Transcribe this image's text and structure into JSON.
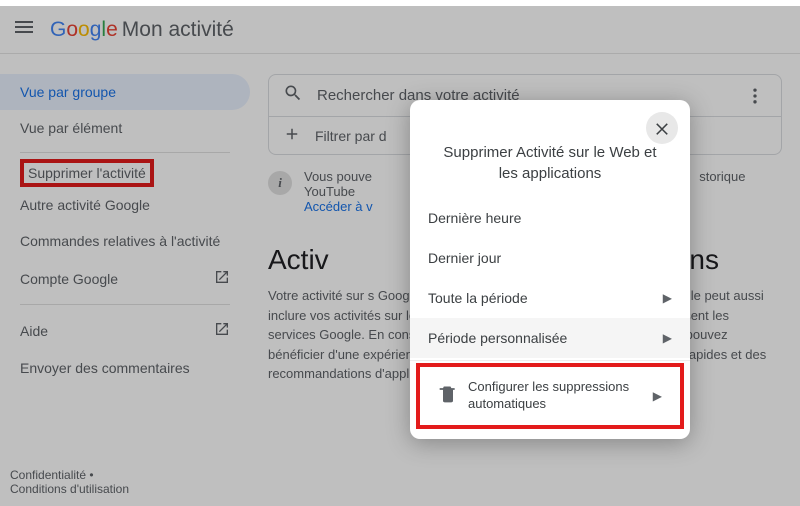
{
  "appbar": {
    "logo_word": "Google",
    "app_name": "Mon activité"
  },
  "sidebar": {
    "items": [
      {
        "label": "Vue par groupe"
      },
      {
        "label": "Vue par élément"
      },
      {
        "label": "Supprimer l'activité"
      },
      {
        "label": "Autre activité Google"
      },
      {
        "label": "Commandes relatives à l'activité"
      },
      {
        "label": "Compte Google"
      },
      {
        "label": "Aide"
      },
      {
        "label": "Envoyer des commentaires"
      }
    ]
  },
  "footer": {
    "privacy": "Confidentialité",
    "sep": " • ",
    "terms": "Conditions d'utilisation"
  },
  "search": {
    "placeholder": "Rechercher dans votre activité",
    "filter": "Filtrer par d"
  },
  "info": {
    "text1": "Vous pouve",
    "text2": "storique YouTube",
    "link": "Accéder à v"
  },
  "section": {
    "title_left": "Activ",
    "title_right": "ations",
    "desc": "Votre activité sur                              s Google tels que Maps, Play et la recherche Google. Elle peut aussi inclure vos activités sur les sites, les applications et les appareils qui utilisent les services Google. En conservant des données liées à votre activité, vous pouvez bénéficier d'une expérience personnalisée, comme des recherches plus rapides et des recommandations d'applications et de contenus plus utiles."
  },
  "modal": {
    "title": "Supprimer Activité sur le Web et les applications",
    "items": [
      {
        "label": "Dernière heure"
      },
      {
        "label": "Dernier jour"
      },
      {
        "label": "Toute la période"
      },
      {
        "label": "Période personnalisée"
      }
    ],
    "auto": "Configurer les suppressions automatiques"
  }
}
